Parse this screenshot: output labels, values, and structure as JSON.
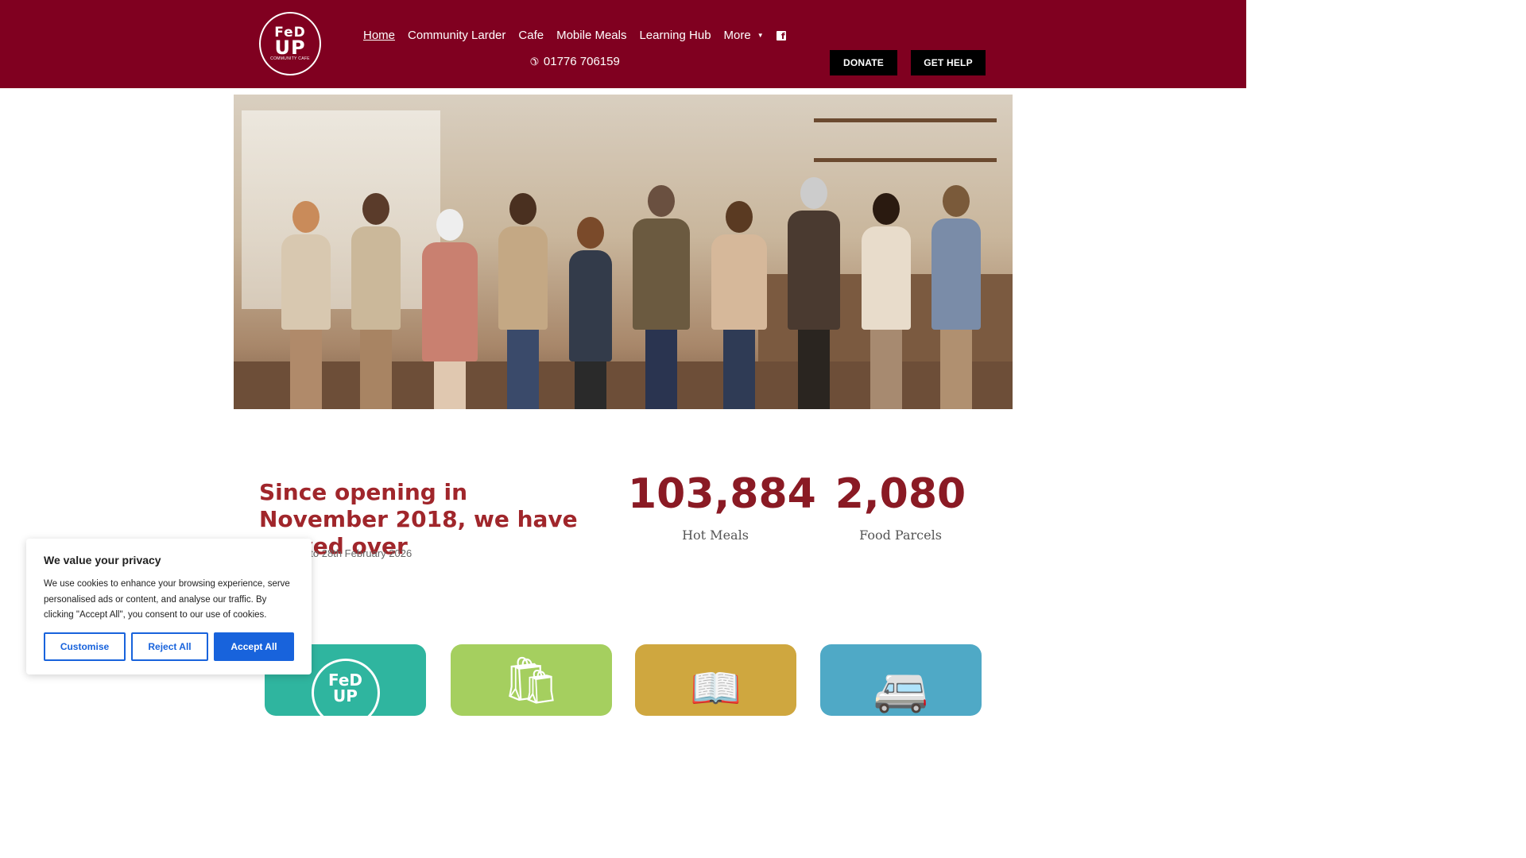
{
  "header": {
    "logo": {
      "line1": "FeD",
      "line2": "UP",
      "line3": "COMMUNITY CAFE"
    },
    "nav": [
      {
        "label": "Home",
        "active": true
      },
      {
        "label": "Community Larder"
      },
      {
        "label": "Cafe"
      },
      {
        "label": "Mobile Meals"
      },
      {
        "label": "Learning Hub"
      },
      {
        "label": "More"
      }
    ],
    "facebook_icon": "facebook-icon",
    "phone": "01776 706159",
    "donate_label": "DONATE",
    "get_help_label": "GET HELP",
    "brand_color": "#800020"
  },
  "hero": {
    "image_icon": "community-people-photo"
  },
  "stats": {
    "headline": "Since opening in November 2018, we have served over",
    "note": "Correct up to 28th February 2026",
    "items": [
      {
        "value": "103,884",
        "label": "Hot Meals"
      },
      {
        "value": "2,080",
        "label": "Food Parcels"
      }
    ],
    "accent_color": "#8a1a24"
  },
  "tiles": [
    {
      "icon": "fed-up-logo-icon",
      "logo_text": "FeD UP",
      "color": "#2fb59f"
    },
    {
      "icon": "shopping-bag-icon",
      "color": "#a5cf5f"
    },
    {
      "icon": "book-icon",
      "color": "#cfa73f"
    },
    {
      "icon": "delivery-van-icon",
      "color": "#4fa9c6"
    }
  ],
  "cookie": {
    "title": "We value your privacy",
    "body": "We use cookies to enhance your browsing experience, serve personalised ads or content, and analyse our traffic. By clicking \"Accept All\", you consent to our use of cookies.",
    "customise_label": "Customise",
    "reject_label": "Reject All",
    "accept_label": "Accept All",
    "button_color": "#1863dc"
  }
}
